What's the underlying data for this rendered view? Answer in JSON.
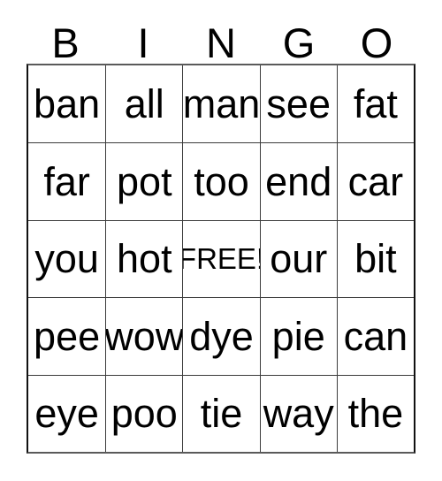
{
  "card": {
    "type": "bingo-card",
    "header": {
      "letters": [
        "B",
        "I",
        "N",
        "G",
        "O"
      ]
    },
    "grid": {
      "columns": 5,
      "rows": 5,
      "free_space": {
        "row": 2,
        "column": 2,
        "label": "FREE!"
      },
      "cells": [
        [
          "ban",
          "all",
          "man",
          "see",
          "fat"
        ],
        [
          "far",
          "pot",
          "too",
          "end",
          "car"
        ],
        [
          "you",
          "hot",
          "FREE!",
          "our",
          "bit"
        ],
        [
          "pee",
          "wow",
          "dye",
          "pie",
          "can"
        ],
        [
          "eye",
          "poo",
          "tie",
          "way",
          "the"
        ]
      ]
    },
    "colors": {
      "background": "#ffffff",
      "text": "#000000",
      "grid_line": "#3c3c3c",
      "outer_border": "#111111"
    }
  }
}
